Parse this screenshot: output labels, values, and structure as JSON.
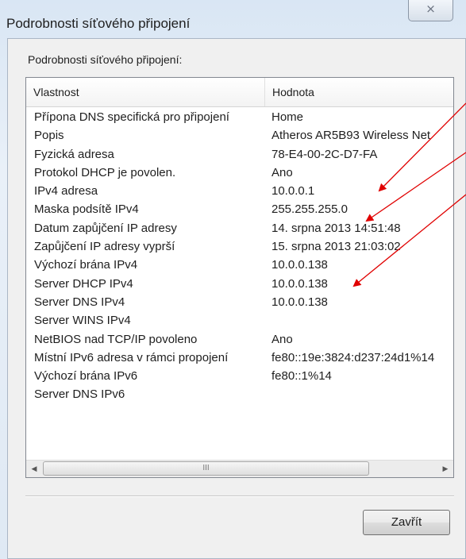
{
  "window": {
    "title": "Podrobnosti síťového připojení",
    "close_glyph": "⨯"
  },
  "group": {
    "label": "Podrobnosti síťového připojení:"
  },
  "table": {
    "columns": [
      "Vlastnost",
      "Hodnota"
    ],
    "rows": [
      {
        "property": "Přípona DNS specifická pro připojení",
        "value": "Home"
      },
      {
        "property": "Popis",
        "value": "Atheros AR5B93 Wireless Net"
      },
      {
        "property": "Fyzická adresa",
        "value": "78-E4-00-2C-D7-FA"
      },
      {
        "property": "Protokol DHCP je povolen.",
        "value": "Ano"
      },
      {
        "property": "IPv4 adresa",
        "value": "10.0.0.1"
      },
      {
        "property": "Maska podsítě IPv4",
        "value": "255.255.255.0"
      },
      {
        "property": "Datum zapůjčení IP adresy",
        "value": "14. srpna 2013 14:51:48"
      },
      {
        "property": "Zapůjčení IP adresy vyprší",
        "value": "15. srpna 2013 21:03:02"
      },
      {
        "property": "Výchozí brána IPv4",
        "value": "10.0.0.138"
      },
      {
        "property": "Server DHCP IPv4",
        "value": "10.0.0.138"
      },
      {
        "property": "Server DNS IPv4",
        "value": "10.0.0.138"
      },
      {
        "property": "Server WINS IPv4",
        "value": ""
      },
      {
        "property": "NetBIOS nad TCP/IP povoleno",
        "value": "Ano"
      },
      {
        "property": "Místní IPv6 adresa v rámci propojení",
        "value": "fe80::19e:3824:d237:24d1%14"
      },
      {
        "property": "Výchozí brána IPv6",
        "value": "fe80::1%14"
      },
      {
        "property": "Server DNS IPv6",
        "value": ""
      }
    ]
  },
  "scrollbar": {
    "left_arrow": "◀",
    "right_arrow": "▶",
    "thumb_grip": "III"
  },
  "buttons": {
    "close_label": "Zavřít"
  },
  "colors": {
    "annotation_arrow": "#e00000"
  }
}
